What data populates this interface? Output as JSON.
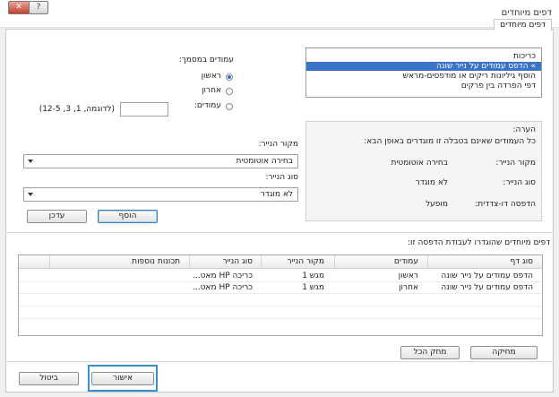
{
  "window": {
    "title": "דפים מיוחדים",
    "tab": "דפים מיוחדים",
    "close_symbol": "✕",
    "help_symbol": "?"
  },
  "list": {
    "items": [
      {
        "label": "כריכות",
        "selected": false
      },
      {
        "label": "הדפס עמודים על נייר שונה",
        "selected": true,
        "marker": "»"
      },
      {
        "label": "הוסף גיליונות ריקים או מודפסים-מראש",
        "selected": false
      },
      {
        "label": "דפי הפרדה בין פרקים",
        "selected": false
      }
    ]
  },
  "pages_in_doc": {
    "label": "עמודים במסמך:",
    "options": [
      {
        "label": "ראשון",
        "checked": true
      },
      {
        "label": "אחרון",
        "checked": false
      },
      {
        "label": "עמודים:",
        "checked": false
      }
    ],
    "pages_value": "",
    "example": "(לדוגמה, 1, 3, 12-5)"
  },
  "note": {
    "title": "הערה:",
    "text": "כל העמודים שאינם בטבלה זו מוגדרים באופן הבא:",
    "rows": [
      {
        "label": "מקור הנייר:",
        "value": "בחירה אוטומטית"
      },
      {
        "label": "סוג הנייר:",
        "value": "לא מוגדר"
      },
      {
        "label": "הדפסה דו-צדדית:",
        "value": "מופעל"
      }
    ]
  },
  "paper_source": {
    "label": "מקור הנייר:",
    "value": "בחירה אוטומטית"
  },
  "paper_type": {
    "label": "סוג הנייר:",
    "value": "לא מוגדר"
  },
  "buttons": {
    "add": "הוסף",
    "update": "עדכן",
    "delete": "מחיקה",
    "clear_all": "מחק הכל",
    "ok": "אישור",
    "cancel": "ביטול"
  },
  "table": {
    "caption": "דפים מיוחדים שהוגדרו לעבודת הדפסה זו:",
    "columns": [
      "סוג דף",
      "עמודים",
      "מקור הנייר",
      "סוג הנייר",
      "תכונות נוספות"
    ],
    "rows": [
      [
        "הדפס עמודים על נייר שונה",
        "ראשון",
        "מגש 1",
        "כריכה HP מאט...",
        ""
      ],
      [
        "הדפס עמודים על נייר שונה",
        "אחרון",
        "מגש 1",
        "כריכה HP מאט...",
        ""
      ]
    ]
  },
  "colors": {
    "selection": "#3a73c8",
    "focus_frame": "#3a8fd0",
    "close_button": "#c0402c"
  }
}
